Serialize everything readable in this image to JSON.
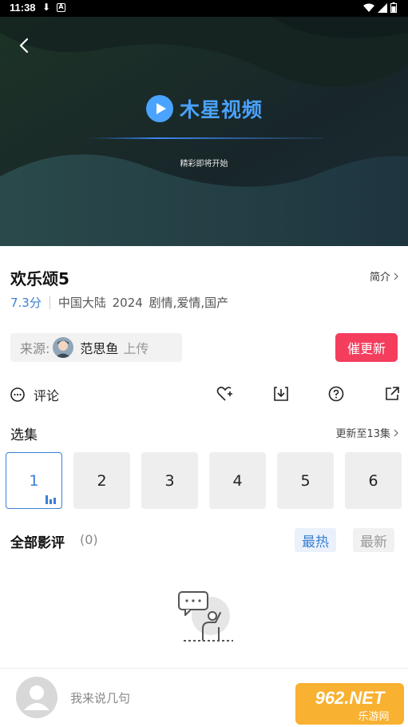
{
  "status_bar": {
    "time": "11:38"
  },
  "player": {
    "brand_name": "木星视频",
    "tagline": "精彩即将开始"
  },
  "show": {
    "title": "欢乐颂5",
    "intro_label": "简介",
    "score": "7.3分",
    "info": "中国大陆 2024 剧情,爱情,国产"
  },
  "source": {
    "label": "来源:",
    "uploader": "范思鱼",
    "upload_text": "上传",
    "update_button": "催更新"
  },
  "actions": {
    "comment_label": "评论"
  },
  "episodes": {
    "title": "选集",
    "update_label": "更新至13集",
    "items": [
      "1",
      "2",
      "3",
      "4",
      "5",
      "6"
    ],
    "active_index": 0
  },
  "reviews": {
    "title": "全部影评",
    "count": "(0)",
    "sort_hot": "最热",
    "sort_new": "最新"
  },
  "bottom": {
    "comment_placeholder": "我来说几句",
    "watermark_text": "962.NET",
    "watermark_sub": "乐游网"
  },
  "colors": {
    "accent": "#3b7fd4",
    "update_button": "#f53d5e",
    "brand": "#4aa3ff"
  }
}
